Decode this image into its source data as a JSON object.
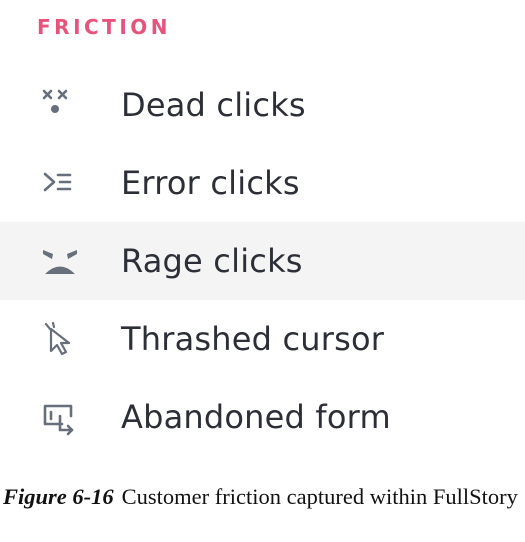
{
  "section": {
    "title": "FRICTION"
  },
  "items": [
    {
      "label": "Dead clicks",
      "icon": "dead-clicks-icon"
    },
    {
      "label": "Error clicks",
      "icon": "error-clicks-icon"
    },
    {
      "label": "Rage clicks",
      "icon": "rage-clicks-icon"
    },
    {
      "label": "Thrashed cursor",
      "icon": "thrashed-cursor-icon"
    },
    {
      "label": "Abandoned form",
      "icon": "abandoned-form-icon"
    }
  ],
  "caption": {
    "figure_label": "Figure 6-16",
    "text": "Customer friction captured within FullStory"
  },
  "colors": {
    "accent": "#e8537c",
    "icon": "#676e7c",
    "text": "#2c2f37",
    "highlight_row": "#f4f4f4"
  }
}
